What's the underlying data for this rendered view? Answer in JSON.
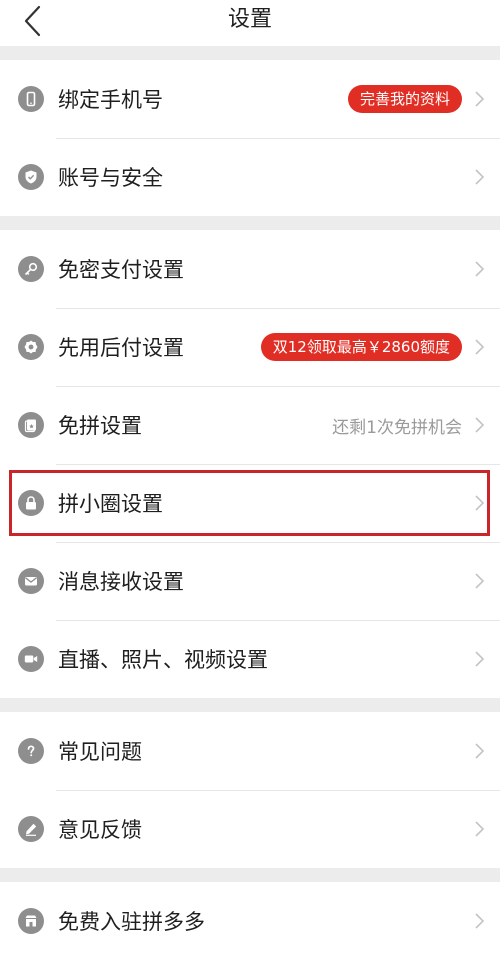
{
  "header": {
    "title": "设置"
  },
  "sections": [
    {
      "items": [
        {
          "label": "绑定手机号",
          "icon": "phone-icon",
          "badge": "完善我的资料"
        },
        {
          "label": "账号与安全",
          "icon": "shield-icon"
        }
      ]
    },
    {
      "items": [
        {
          "label": "免密支付设置",
          "icon": "key-icon"
        },
        {
          "label": "先用后付设置",
          "icon": "badge-icon",
          "badge": "双12领取最高￥2860额度"
        },
        {
          "label": "免拼设置",
          "icon": "card-icon",
          "hint": "还剩1次免拼机会"
        },
        {
          "label": "拼小圈设置",
          "icon": "lock-icon"
        },
        {
          "label": "消息接收设置",
          "icon": "mail-icon"
        },
        {
          "label": "直播、照片、视频设置",
          "icon": "video-icon"
        }
      ]
    },
    {
      "items": [
        {
          "label": "常见问题",
          "icon": "question-icon"
        },
        {
          "label": "意见反馈",
          "icon": "pencil-icon"
        }
      ]
    },
    {
      "items": [
        {
          "label": "免费入驻拼多多",
          "icon": "store-icon"
        }
      ]
    }
  ],
  "colors": {
    "accent": "#e02e24",
    "highlight_border": "#c8262a",
    "icon_bg": "#8e8e8e"
  }
}
